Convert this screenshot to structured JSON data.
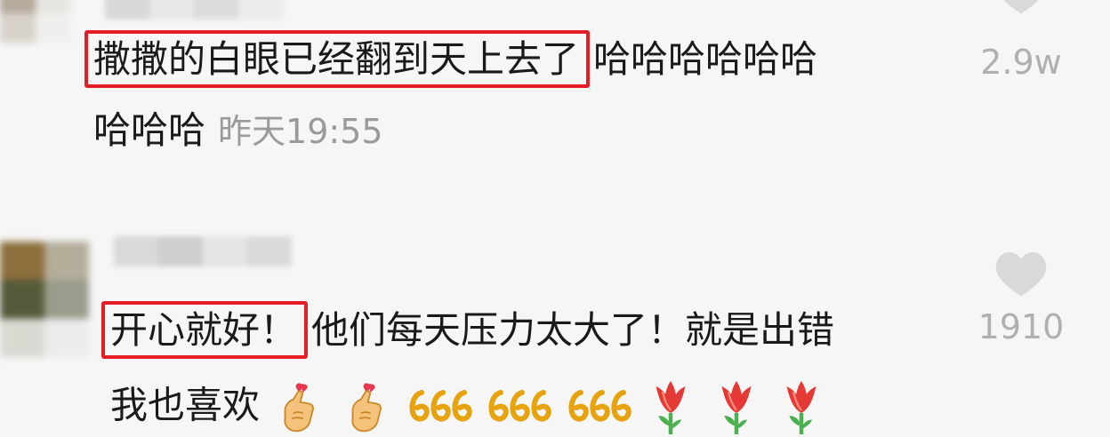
{
  "comments": [
    {
      "highlight_text": "撒撒的白眼已经翻到天上去了",
      "rest_line_1": "哈哈哈哈哈哈",
      "line_2": "哈哈哈",
      "timestamp": "昨天19:55",
      "like_count": "2.9w",
      "avatar_colors": [
        "#b5a99a",
        "#e8e6e2",
        "#d6d2cb",
        "#f0efed"
      ],
      "username_colors": [
        "#d8d8d8",
        "#e7e7e7",
        "#dcdcdc",
        "#ececec"
      ]
    },
    {
      "highlight_text": "开心就好！",
      "rest_line_1": "他们每天压力太大了！就是出错",
      "line_2_text": "我也喜欢",
      "line_2_emojis": [
        "finger-heart",
        "finger-heart",
        "666",
        "666",
        "666",
        "tulip",
        "tulip",
        "tulip"
      ],
      "like_count": "1910",
      "avatar_colors": [
        "#8c6f3c",
        "#b4ad9a",
        "#555b3a",
        "#9c9c8c",
        "#d9d9d2",
        "#ececec"
      ],
      "username_colors": [
        "#d9d9d9",
        "#cfcfcf",
        "#e4e4e4",
        "#dadada"
      ]
    }
  ],
  "colors": {
    "highlight_border": "#e41e25",
    "text": "#1a1a1a",
    "muted": "#9a9a9a",
    "heart": "#d9d9d9"
  }
}
